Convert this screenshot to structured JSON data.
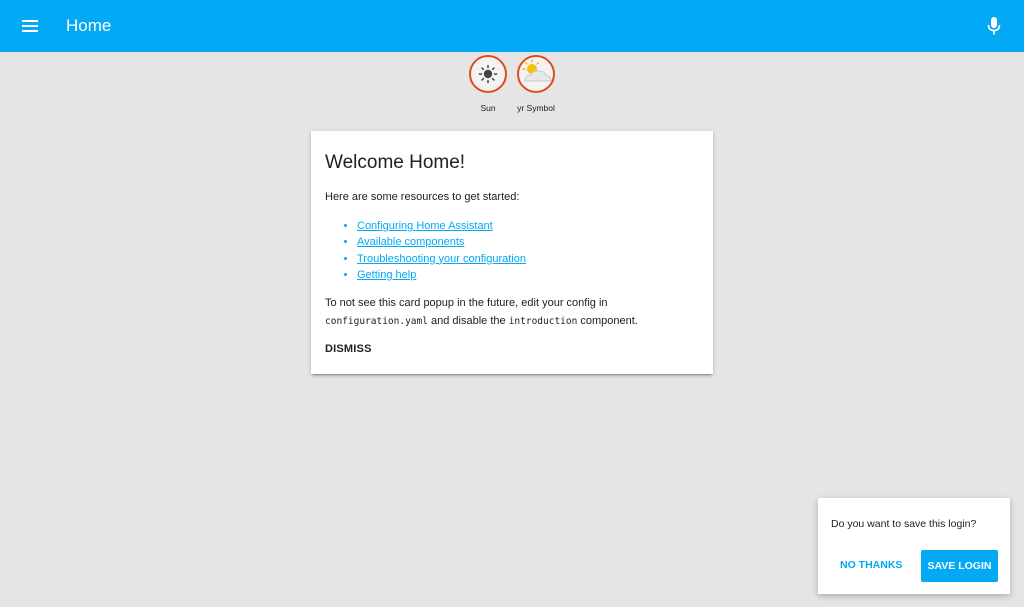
{
  "header": {
    "title": "Home",
    "menu_icon": "menu-icon",
    "mic_icon": "microphone-icon",
    "background_color": "#03a9f4"
  },
  "badges": [
    {
      "label": "Sun",
      "icon": "sun-icon",
      "border_color": "#df4c1e"
    },
    {
      "label": "yr Symbol",
      "icon": "partly-cloudy-icon",
      "border_color": "#df4c1e"
    }
  ],
  "card": {
    "title": "Welcome Home!",
    "intro": "Here are some resources to get started:",
    "links": [
      "Configuring Home Assistant",
      "Available components",
      "Troubleshooting your configuration",
      "Getting help"
    ],
    "note_part1": "To not see this card popup in the future, edit your config in",
    "note_code1": "configuration.yaml",
    "note_part2": " and disable the ",
    "note_code2": "introduction",
    "note_part3": " component.",
    "dismiss_label": "DISMISS"
  },
  "save_dialog": {
    "question": "Do you want to save this login?",
    "no_thanks_label": "NO THANKS",
    "save_label": "SAVE LOGIN"
  }
}
